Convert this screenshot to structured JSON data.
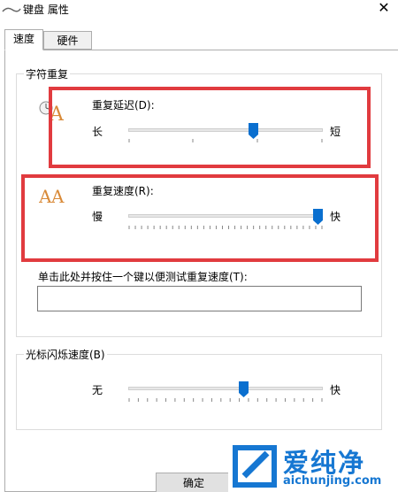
{
  "window": {
    "title": "键盘 属性",
    "close_glyph": "✕"
  },
  "tabs": [
    {
      "label": "速度",
      "selected": true
    },
    {
      "label": "硬件",
      "selected": false
    }
  ],
  "char_repeat": {
    "group_title": "字符重复",
    "delay": {
      "label": "重复延迟(D):",
      "min_label": "长",
      "max_label": "短",
      "value": 0.65
    },
    "rate": {
      "label": "重复速度(R):",
      "min_label": "慢",
      "max_label": "快",
      "value": 1.0
    },
    "test_label": "单击此处并按住一个键以便测试重复速度(T):",
    "test_value": ""
  },
  "cursor_blink": {
    "group_title": "光标闪烁速度(B)",
    "min_label": "无",
    "max_label": "快",
    "value": 0.6
  },
  "buttons": {
    "ok": "确定"
  },
  "watermark": {
    "text": "爱纯净",
    "url": "aichunjing.com"
  },
  "colors": {
    "highlight_border": "#e13b3f",
    "slider_thumb": "#0a6fcf",
    "brand": "#1677d2"
  },
  "icons": {
    "keyboard": "keyboard-icon",
    "delay": "letter-a-clock-icon",
    "rate": "letter-aa-icon",
    "close": "close-icon"
  }
}
